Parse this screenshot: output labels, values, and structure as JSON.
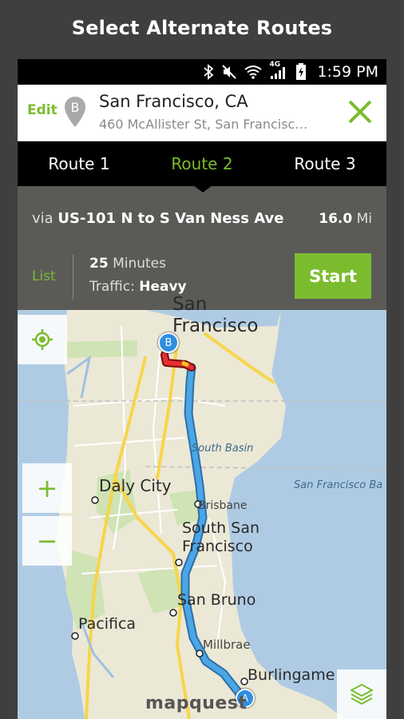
{
  "caption": "Select Alternate Routes",
  "status": {
    "network": "4G",
    "time": "1:59 PM"
  },
  "destination": {
    "edit_label": "Edit",
    "pin_letter": "B",
    "title": "San Francisco, CA",
    "address": "460 McAllister St, San Francisc…"
  },
  "tabs": [
    {
      "label": "Route 1"
    },
    {
      "label": "Route 2"
    },
    {
      "label": "Route 3"
    }
  ],
  "route": {
    "via_prefix": "via",
    "via_road": "US-101 N to S Van Ness Ave",
    "distance": "16.0",
    "distance_unit": "Mi",
    "list_label": "List",
    "duration_value": "25",
    "duration_unit": "Minutes",
    "traffic_label": "Traffic:",
    "traffic_value": "Heavy",
    "start_label": "Start"
  },
  "map": {
    "labels": {
      "san_francisco": "San\nFrancisco",
      "south_basin": "South Basin",
      "sf_bay": "San Francisco Ba",
      "daly_city": "Daly City",
      "brisbane": "Brisbane",
      "south_sf": "South San\nFrancisco",
      "san_bruno": "San Bruno",
      "pacifica": "Pacifica",
      "millbrae": "Millbrae",
      "burlingame": "Burlingame"
    },
    "marker_start": "A",
    "marker_end": "B",
    "brand": "mapquest",
    "zoom_in": "+",
    "zoom_out": "−"
  },
  "colors": {
    "accent": "#7bbc2f",
    "route": "#4ba6e6",
    "water": "#afcbe4",
    "land": "#ece8d6"
  }
}
